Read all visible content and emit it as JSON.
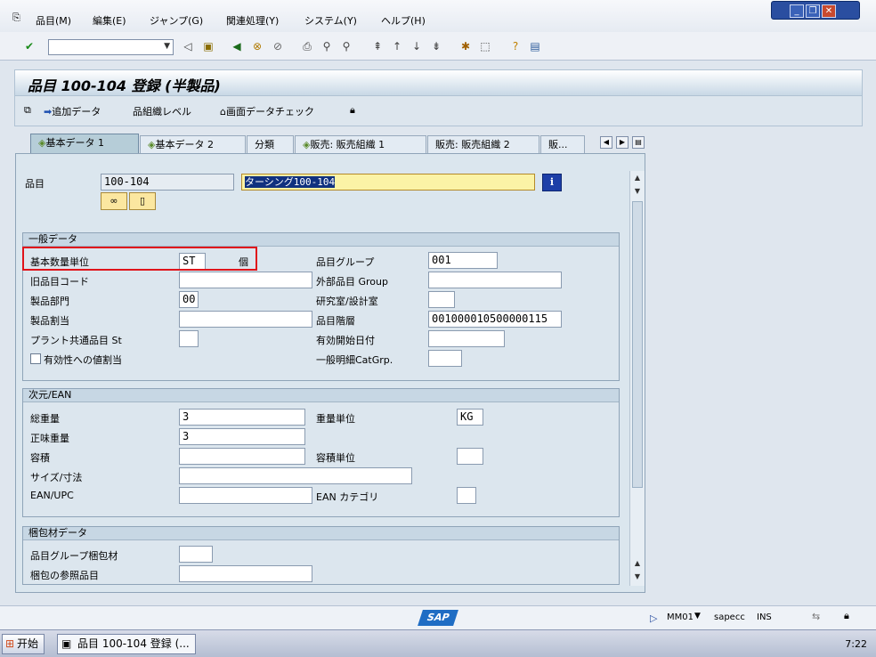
{
  "menu": [
    "品目(M)",
    "編集(E)",
    "ジャンプ(G)",
    "関連処理(Y)",
    "システム(Y)",
    "ヘルプ(H)"
  ],
  "title": "品目 100-104 登録 (半製品)",
  "app_toolbar": {
    "add_data": "追加データ",
    "org_level": "組織レベル",
    "screen_check": "画面データチェック"
  },
  "tabs": [
    "基本データ 1",
    "基本データ 2",
    "分類",
    "販売: 販売組織 1",
    "販売: 販売組織 2",
    "販..."
  ],
  "header": {
    "material_label": "品目",
    "material_value": "100-104",
    "description": "ターシング100-104"
  },
  "general": {
    "heading": "一般データ",
    "base_uom_label": "基本数量単位",
    "base_uom_value": "ST",
    "base_uom_text": "個",
    "old_material_label": "旧品目コード",
    "old_material_value": "",
    "division_label": "製品部門",
    "division_value": "00",
    "product_alloc_label": "製品割当",
    "product_alloc_value": "",
    "plant_status_label": "プラント共通品目 St",
    "plant_status_value": "",
    "validity_label": "有効性への値割当",
    "mat_group_label": "品目グループ",
    "mat_group_value": "001",
    "ext_group_label": "外部品目 Group",
    "ext_group_value": "",
    "lab_label": "研究室/設計室",
    "lab_value": "",
    "hierarchy_label": "品目階層",
    "hierarchy_value": "001000010500000115",
    "valid_from_label": "有効開始日付",
    "valid_from_value": "",
    "item_cat_label": "一般明細CatGrp.",
    "item_cat_value": ""
  },
  "dimensions": {
    "heading": "次元/EAN",
    "gross_label": "総重量",
    "gross_value": "3",
    "net_label": "正味重量",
    "net_value": "3",
    "volume_label": "容積",
    "volume_value": "",
    "size_label": "サイズ/寸法",
    "size_value": "",
    "ean_label": "EAN/UPC",
    "ean_value": "",
    "weight_unit_label": "重量単位",
    "weight_unit_value": "KG",
    "volume_unit_label": "容積単位",
    "volume_unit_value": "",
    "ean_cat_label": "EAN カテゴリ",
    "ean_cat_value": ""
  },
  "packaging": {
    "heading": "梱包材データ",
    "matgroup_pack_label": "品目グループ梱包材",
    "matgroup_pack_value": "",
    "ref_mat_label": "梱包の参照品目",
    "ref_mat_value": ""
  },
  "status": {
    "system": "MM01",
    "server": "sapecc",
    "mode": "INS"
  },
  "taskbar": {
    "start": "开始",
    "item": "品目 100-104 登録 (...",
    "clock": "7:22"
  }
}
